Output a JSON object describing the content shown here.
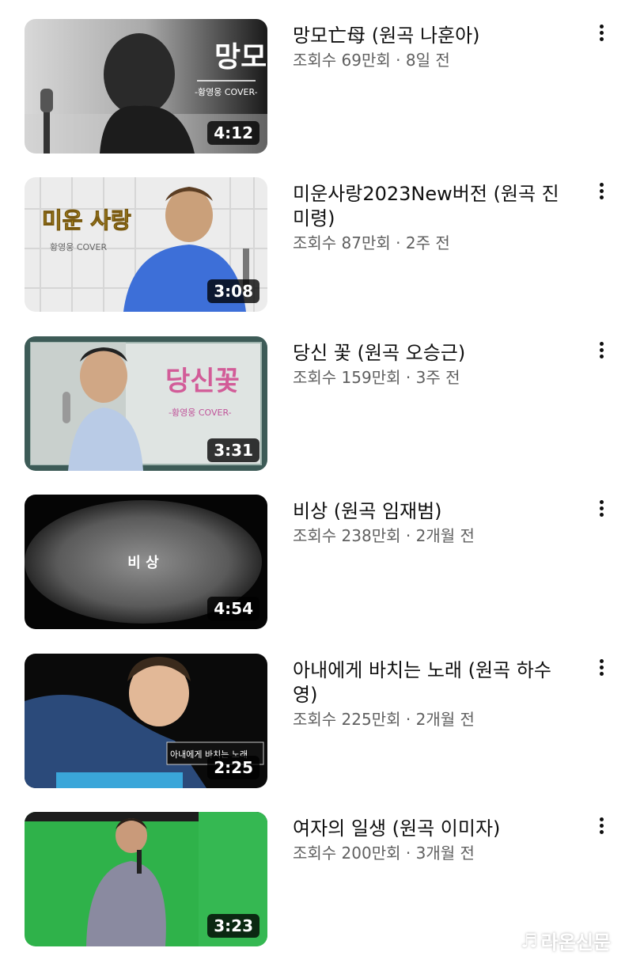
{
  "videos": [
    {
      "title": "망모亡母 (원곡 나훈아)",
      "meta": "조회수 69만회 · 8일 전",
      "duration": "4:12",
      "thumb_text": "망모",
      "thumb_sub": "-황영웅 COVER-"
    },
    {
      "title": "미운사랑2023New버전 (원곡 진미령)",
      "meta": "조회수 87만회 · 2주 전",
      "duration": "3:08",
      "thumb_text": "미운 사랑",
      "thumb_sub": "황영웅 COVER"
    },
    {
      "title": "당신 꽃 (원곡 오승근)",
      "meta": "조회수 159만회 · 3주 전",
      "duration": "3:31",
      "thumb_text": "당신꽃",
      "thumb_sub": "-황영웅 COVER-"
    },
    {
      "title": "비상 (원곡 임재범)",
      "meta": "조회수 238만회 · 2개월 전",
      "duration": "4:54",
      "thumb_text": "비 상"
    },
    {
      "title": "아내에게 바치는 노래 (원곡 하수영)",
      "meta": "조회수 225만회 · 2개월 전",
      "duration": "2:25",
      "thumb_text": "아내에게 바치는 노래"
    },
    {
      "title": "여자의 일생 (원곡 이미자)",
      "meta": "조회수 200만회 · 3개월 전",
      "duration": "3:23"
    }
  ],
  "watermark": "라온신문"
}
